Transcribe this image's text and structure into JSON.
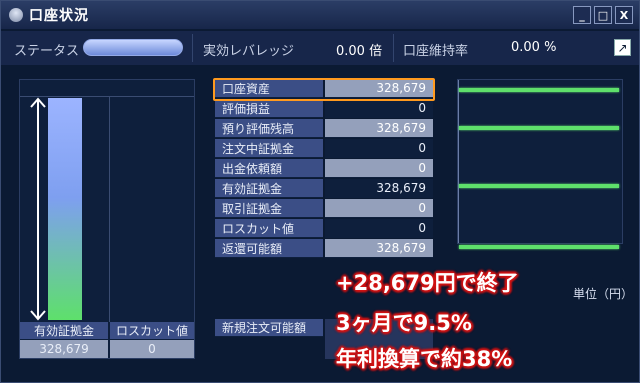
{
  "window": {
    "title": "口座状況",
    "minimize": "_",
    "maximize": "□",
    "close": "X"
  },
  "status": {
    "label": "ステータス",
    "leverage_label": "実効レバレッジ",
    "leverage_value": "0.00 倍",
    "margin_rate_label": "口座維持率",
    "margin_rate_value": "0.00 %",
    "expand_icon": "↗"
  },
  "left": {
    "bar_level": 1.0,
    "col1_label": "有効証拠金",
    "col2_label": "ロスカット値",
    "col1_value": "328,679",
    "col2_value": "0"
  },
  "table": {
    "rows": [
      {
        "label": "口座資産",
        "value": "328,679"
      },
      {
        "label": "評価損益",
        "value": "0"
      },
      {
        "label": "預り評価残高",
        "value": "328,679"
      },
      {
        "label": "注文中証拠金",
        "value": "0"
      },
      {
        "label": "出金依頼額",
        "value": "0"
      },
      {
        "label": "有効証拠金",
        "value": "328,679"
      },
      {
        "label": "取引証拠金",
        "value": "0"
      },
      {
        "label": "ロスカット値",
        "value": "0"
      },
      {
        "label": "返還可能額",
        "value": "328,679"
      }
    ],
    "new_order_label": "新規注文可能額"
  },
  "right": {
    "unit_label": "単位（円）"
  },
  "overlay": {
    "line1": "+28,679円で終了",
    "line2": "3ヶ月で9.5%",
    "line3": "年利換算で約38%"
  },
  "colors": {
    "accent": "#ff9a1f",
    "bar_green": "#5ee06b",
    "overlay_glow": "#d21414"
  }
}
